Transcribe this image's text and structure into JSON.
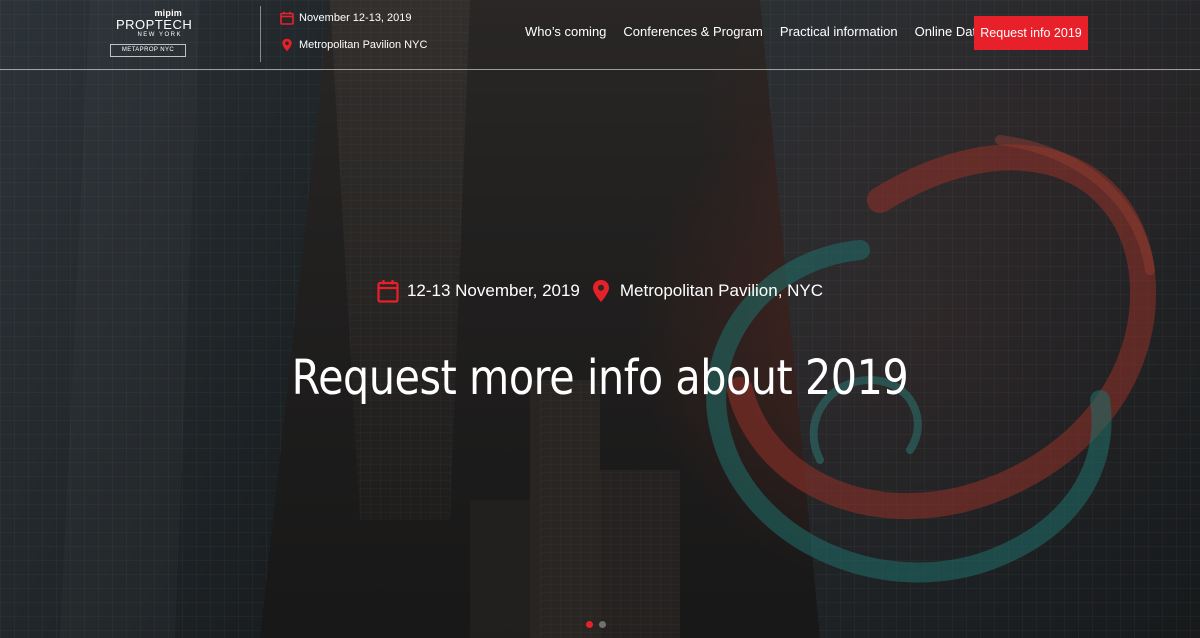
{
  "colors": {
    "accent": "#e8202a",
    "text": "#ffffff",
    "header_rule": "#d9d9d9"
  },
  "header": {
    "logo": {
      "brand_top": "mipim",
      "brand_main": "PROPTECH",
      "brand_city": "NEW YORK",
      "partner": "METAPROP NYC"
    },
    "event_date": "November 12-13, 2019",
    "event_venue": "Metropolitan Pavilion NYC",
    "icons": {
      "date": "calendar-icon",
      "venue": "map-pin-icon"
    }
  },
  "nav": {
    "items": [
      {
        "label": "Who’s coming"
      },
      {
        "label": "Conferences & Program"
      },
      {
        "label": "Practical information"
      },
      {
        "label": "Online Database"
      }
    ],
    "cta_label": "Request info 2019"
  },
  "hero": {
    "date": "12-13 November, 2019",
    "venue": "Metropolitan Pavilion, NYC",
    "title": "Request more info about 2019"
  },
  "carousel": {
    "slide_count": 2,
    "active_index": 0
  }
}
